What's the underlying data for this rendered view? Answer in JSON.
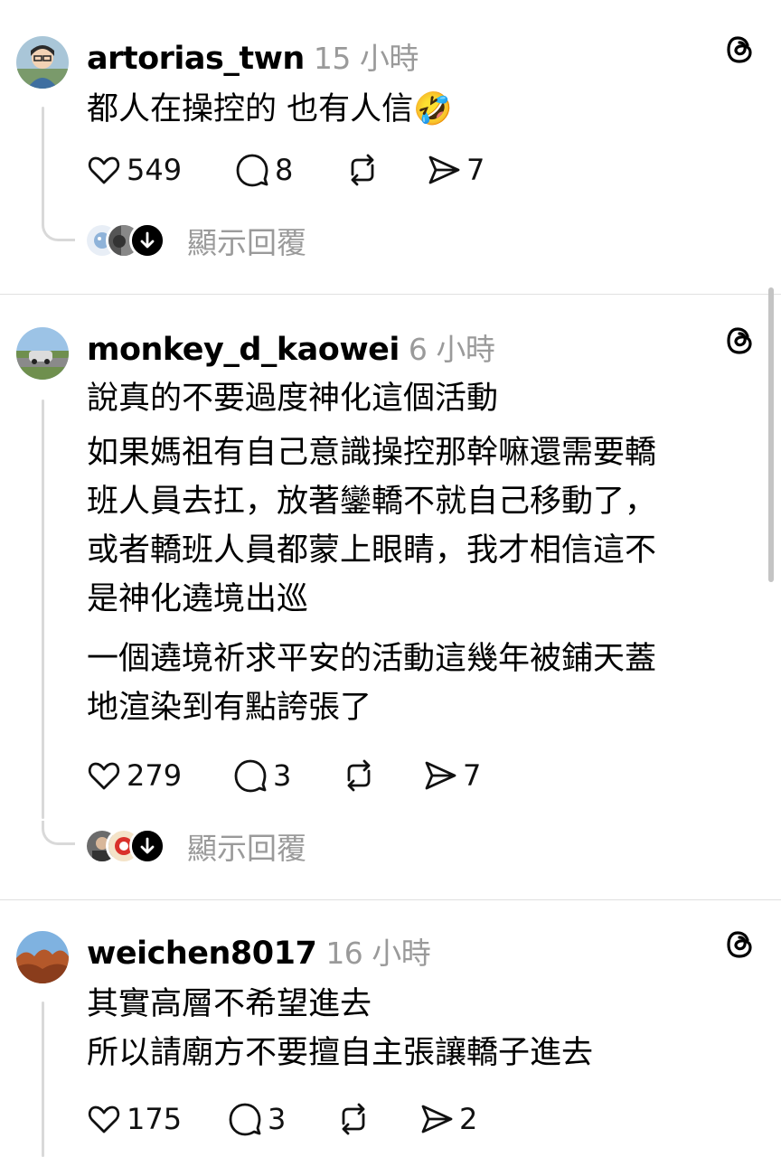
{
  "posts": [
    {
      "username": "artorias_twn",
      "time": "15 小時",
      "lines": [
        "都人在操控的  也有人信🤣"
      ],
      "paragraphs_extra": [],
      "likes": "549",
      "comments": "8",
      "shares": "7",
      "show_replies": "顯示回覆"
    },
    {
      "username": "monkey_d_kaowei",
      "time": "6 小時",
      "lines": [
        "說真的不要過度神化這個活動",
        "如果媽祖有自己意識操控那幹嘛還需要轎",
        "班人員去扛，放著鑾轎不就自己移動了，",
        "或者轎班人員都蒙上眼睛，我才相信這不",
        "是神化遶境出巡"
      ],
      "paragraphs_extra": [
        "一個遶境祈求平安的活動這幾年被鋪天蓋",
        "地渲染到有點誇張了"
      ],
      "likes": "279",
      "comments": "3",
      "shares": "7",
      "show_replies": "顯示回覆"
    },
    {
      "username": "weichen8017",
      "time": "16 小時",
      "lines": [
        "其實高層不希望進去",
        "所以請廟方不要擅自主張讓轎子進去"
      ],
      "paragraphs_extra": [],
      "likes": "175",
      "comments": "3",
      "shares": "2",
      "show_replies": ""
    }
  ],
  "icons": {
    "like": "heart-icon",
    "comment": "comment-bubble-icon",
    "repost": "repost-icon",
    "share": "send-icon",
    "threads": "threads-logo-icon"
  }
}
